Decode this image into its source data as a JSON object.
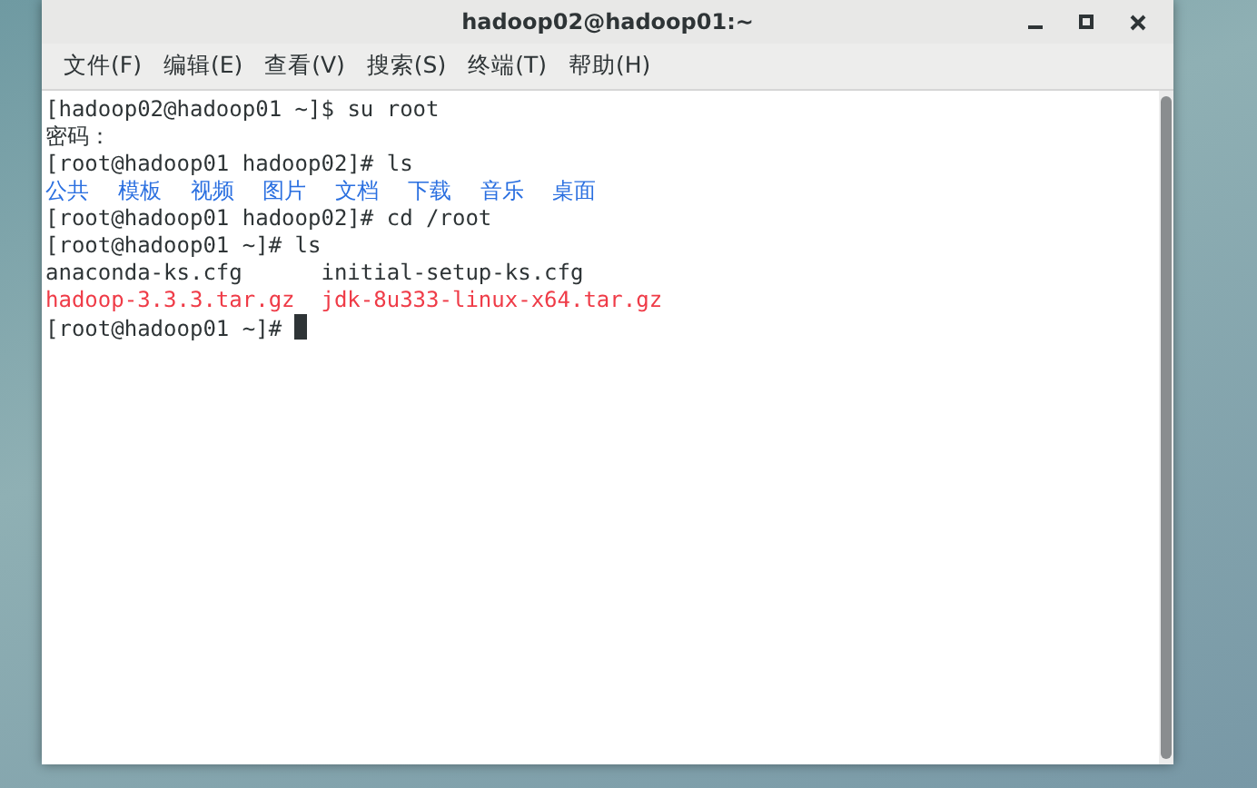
{
  "window": {
    "title": "hadoop02@hadoop01:~"
  },
  "menu": [
    "文件(F)",
    "编辑(E)",
    "查看(V)",
    "搜索(S)",
    "终端(T)",
    "帮助(H)"
  ],
  "lines": [
    {
      "kind": "command",
      "prompt": "[hadoop02@hadoop01 ~]$",
      "command": "su root"
    },
    {
      "kind": "text",
      "text": "密码："
    },
    {
      "kind": "command",
      "prompt": "[root@hadoop01 hadoop02]#",
      "command": "ls"
    },
    {
      "kind": "listing",
      "rows": [
        [
          {
            "text": "公共",
            "kind": "directory"
          },
          {
            "text": "模板",
            "kind": "directory"
          },
          {
            "text": "视频",
            "kind": "directory"
          },
          {
            "text": "图片",
            "kind": "directory"
          },
          {
            "text": "文档",
            "kind": "directory"
          },
          {
            "text": "下载",
            "kind": "directory"
          },
          {
            "text": "音乐",
            "kind": "directory"
          },
          {
            "text": "桌面",
            "kind": "directory"
          }
        ]
      ]
    },
    {
      "kind": "command",
      "prompt": "[root@hadoop01 hadoop02]#",
      "command": "cd /root"
    },
    {
      "kind": "command",
      "prompt": "[root@hadoop01 ~]#",
      "command": "ls"
    },
    {
      "kind": "listing",
      "rows": [
        [
          {
            "text": "anaconda-ks.cfg",
            "kind": "file"
          },
          {
            "text": "initial-setup-ks.cfg",
            "kind": "file"
          }
        ],
        [
          {
            "text": "hadoop-3.3.3.tar.gz",
            "kind": "archive"
          },
          {
            "text": "jdk-8u333-linux-x64.tar.gz",
            "kind": "archive"
          }
        ]
      ]
    },
    {
      "kind": "command",
      "prompt": "[root@hadoop01 ~]#",
      "cursor": true
    }
  ]
}
